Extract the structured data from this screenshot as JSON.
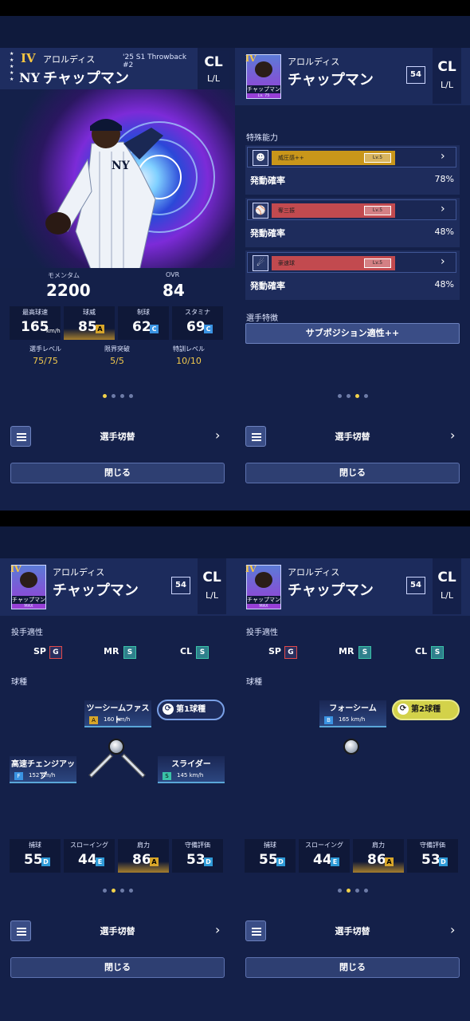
{
  "common": {
    "player_first": "アロルディス",
    "player_last": "チャップマン",
    "position": "CL",
    "handed": "L/L",
    "menu_icon": "hamburger-icon",
    "switch_label": "選手切替",
    "prev_arrow": "‹",
    "next_arrow": "›",
    "close_label": "閉じる",
    "level_badge": "54"
  },
  "panel1": {
    "rank": "IV",
    "team_logo": "NY",
    "card_series": "'25 S1 Throwback #2",
    "momentum_label": "モメンタム",
    "momentum_value": "2200",
    "ovr_label": "OVR",
    "ovr_value": "84",
    "stats": [
      {
        "label": "最高球速",
        "value": "165",
        "unit": "km/h",
        "grade": ""
      },
      {
        "label": "球威",
        "value": "85",
        "unit": "",
        "grade": "A"
      },
      {
        "label": "制球",
        "value": "62",
        "unit": "",
        "grade": "C"
      },
      {
        "label": "スタミナ",
        "value": "69",
        "unit": "",
        "grade": "C"
      }
    ],
    "levels": [
      {
        "label": "選手レベル",
        "value": "75/75"
      },
      {
        "label": "限界突破",
        "value": "5/5"
      },
      {
        "label": "特訓レベル",
        "value": "10/10"
      }
    ]
  },
  "panel2": {
    "avatar_rank": "IV",
    "avatar_plate": "チャップマン",
    "avatar_sub": "Lv. 75",
    "special_title": "特殊能力",
    "abilities": [
      {
        "name": "威圧感++",
        "level": "Lv.5",
        "prob_label": "発動確率",
        "prob": "78%",
        "color": "#c9961a",
        "icon": "face-icon"
      },
      {
        "name": "奪三振",
        "level": "Lv.5",
        "prob_label": "発動確率",
        "prob": "48%",
        "color": "#c24a4f",
        "icon": "pitcher-icon"
      },
      {
        "name": "豪速球",
        "level": "Lv.5",
        "prob_label": "発動確率",
        "prob": "48%",
        "color": "#c24a4f",
        "icon": "fastball-icon"
      }
    ],
    "trait_title": "選手特徴",
    "trait_button": "サブポジション適性++"
  },
  "bottom": {
    "avatar_plate": "チャップマン",
    "avatar_sub": "MAX",
    "aptitude_title": "投手適性",
    "aptitudes": [
      {
        "label": "SP",
        "grade": "G"
      },
      {
        "label": "MR",
        "grade": "S"
      },
      {
        "label": "CL",
        "grade": "S"
      }
    ],
    "pitch_title": "球種",
    "fielding": [
      {
        "label": "捕球",
        "value": "55",
        "grade": "D"
      },
      {
        "label": "スローイング",
        "value": "44",
        "grade": "E"
      },
      {
        "label": "肩力",
        "value": "86",
        "grade": "A"
      },
      {
        "label": "守備評価",
        "value": "53",
        "grade": "D"
      }
    ]
  },
  "panel3": {
    "pitches": [
      {
        "name": "ツーシームファスト",
        "grade": "A",
        "speed": "160 km/h"
      },
      {
        "name": "高速チェンジアップ",
        "grade": "F",
        "speed": "152 km/h"
      },
      {
        "name": "スライダー",
        "grade": "S",
        "speed": "145 km/h"
      }
    ],
    "pitch_button": "第1球種"
  },
  "panel4": {
    "pitches": [
      {
        "name": "フォーシーム",
        "grade": "B",
        "speed": "165 km/h"
      }
    ],
    "pitch_button": "第2球種"
  },
  "pagination": {
    "panel1_active": 1,
    "panel2_active": 3,
    "panel3_active": 2,
    "panel4_active": 2,
    "count": 4
  },
  "colors": {
    "background": "#142049",
    "accent_gold": "#f2c94c",
    "grade_a": "#d8a62a",
    "grade_s": "#3ac3a8"
  }
}
